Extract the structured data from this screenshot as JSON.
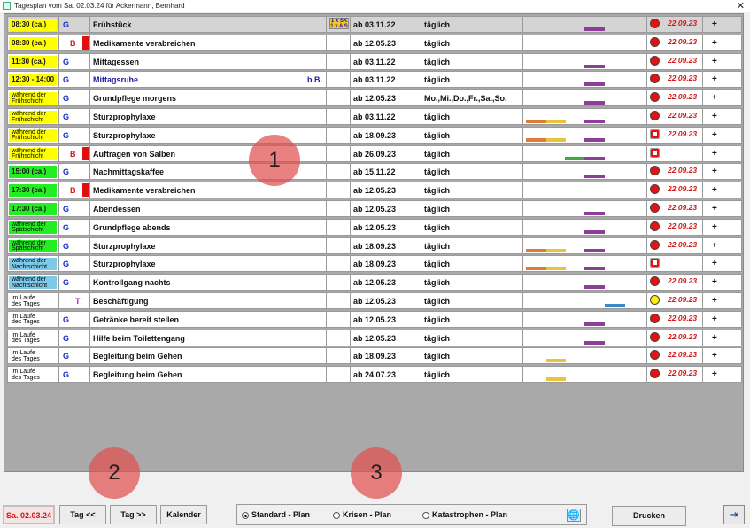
{
  "window": {
    "title": "Tagesplan vom Sa. 02.03.24 für Ackermann, Bernhard",
    "close_symbol": "✕"
  },
  "colors": {
    "time_yellow": "#ffff00",
    "time_green": "#22ee22",
    "time_blue": "#7ec8e8",
    "bar_red": "#e01010",
    "timeline_purple": "#8e3d9a",
    "timeline_orange": "#e07a3a",
    "timeline_yellow": "#e8c43a",
    "timeline_green": "#3caa3c",
    "timeline_blue": "#3a88c8",
    "status_red": "#e81010",
    "status_yellow": "#ffee00",
    "date_red": "#d01818"
  },
  "rows": [
    {
      "time": "08:30 (ca.)",
      "time_color": "yellow",
      "category": "G",
      "cat_color": "blue",
      "red_bar": false,
      "name": "Frühstück",
      "name_right": "",
      "indicator": "1 x SK\n1 x A S",
      "from": "ab 03.11.22",
      "frequency": "täglich",
      "timeline": [
        {
          "color": "purple",
          "start": 0.5,
          "len": 0.17
        }
      ],
      "status": "red",
      "date": "22.09.23",
      "plus": "+"
    },
    {
      "time": "08:30 (ca.)",
      "time_color": "yellow",
      "category": "B",
      "cat_color": "red",
      "red_bar": true,
      "name": "Medikamente verabreichen",
      "name_right": "",
      "indicator": "",
      "from": "ab 12.05.23",
      "frequency": "täglich",
      "timeline": [],
      "status": "red",
      "date": "22.09.23",
      "plus": "+"
    },
    {
      "time": "11:30 (ca.)",
      "time_color": "yellow",
      "category": "G",
      "cat_color": "blue",
      "red_bar": false,
      "name": "Mittagessen",
      "name_right": "",
      "indicator": "",
      "from": "ab 03.11.22",
      "frequency": "täglich",
      "timeline": [
        {
          "color": "purple",
          "start": 0.5,
          "len": 0.17
        }
      ],
      "status": "red",
      "date": "22.09.23",
      "plus": "+"
    },
    {
      "time": "12:30 - 14:00",
      "time_color": "yellow",
      "category": "G",
      "cat_color": "blue",
      "red_bar": false,
      "name": "Mittagsruhe",
      "name_blue": true,
      "name_right": "b.B.",
      "indicator": "",
      "from": "ab 03.11.22",
      "frequency": "täglich",
      "timeline": [
        {
          "color": "purple",
          "start": 0.5,
          "len": 0.17
        }
      ],
      "status": "red",
      "date": "22.09.23",
      "plus": "+"
    },
    {
      "time": "während der\nFrühschicht",
      "time_color": "yellow",
      "category": "G",
      "cat_color": "blue",
      "red_bar": false,
      "name": "Grundpflege morgens",
      "name_right": "",
      "indicator": "",
      "from": "ab 12.05.23",
      "frequency": "Mo.,Mi.,Do.,Fr.,Sa.,So.",
      "timeline": [
        {
          "color": "purple",
          "start": 0.5,
          "len": 0.17
        }
      ],
      "status": "red",
      "date": "22.09.23",
      "plus": "+"
    },
    {
      "time": "während der\nFrühschicht",
      "time_color": "yellow",
      "category": "G",
      "cat_color": "blue",
      "red_bar": false,
      "name": "Sturzprophylaxe",
      "name_right": "",
      "indicator": "",
      "from": "ab 03.11.22",
      "frequency": "täglich",
      "timeline": [
        {
          "color": "orange",
          "start": 0.02,
          "len": 0.17
        },
        {
          "color": "yellow",
          "start": 0.19,
          "len": 0.16
        },
        {
          "color": "purple",
          "start": 0.5,
          "len": 0.17
        }
      ],
      "status": "red",
      "date": "22.09.23",
      "plus": "+"
    },
    {
      "time": "während der\nFrühschicht",
      "time_color": "yellow",
      "category": "G",
      "cat_color": "blue",
      "red_bar": false,
      "name": "Sturzprophylaxe",
      "name_right": "",
      "indicator": "",
      "from": "ab 18.09.23",
      "frequency": "täglich",
      "timeline": [
        {
          "color": "orange",
          "start": 0.02,
          "len": 0.17
        },
        {
          "color": "yellow",
          "start": 0.19,
          "len": 0.16
        },
        {
          "color": "purple",
          "start": 0.5,
          "len": 0.17
        }
      ],
      "status": "red-square",
      "date": "22.09.23",
      "plus": "+"
    },
    {
      "time": "während der\nFrühschicht",
      "time_color": "yellow",
      "category": "B",
      "cat_color": "red",
      "red_bar": true,
      "name": "Auftragen von Salben",
      "name_right": "",
      "indicator": "",
      "from": "ab 26.09.23",
      "frequency": "täglich",
      "timeline": [
        {
          "color": "green",
          "start": 0.34,
          "len": 0.16
        },
        {
          "color": "purple",
          "start": 0.5,
          "len": 0.17
        }
      ],
      "status": "red-square",
      "date": "",
      "plus": "+"
    },
    {
      "time": "15:00 (ca.)",
      "time_color": "green",
      "category": "G",
      "cat_color": "blue",
      "red_bar": false,
      "name": "Nachmittagskaffee",
      "name_right": "",
      "indicator": "",
      "from": "ab 15.11.22",
      "frequency": "täglich",
      "timeline": [
        {
          "color": "purple",
          "start": 0.5,
          "len": 0.17
        }
      ],
      "status": "red",
      "date": "22.09.23",
      "plus": "+"
    },
    {
      "time": "17:30 (ca.)",
      "time_color": "green",
      "category": "B",
      "cat_color": "red",
      "red_bar": true,
      "name": "Medikamente verabreichen",
      "name_right": "",
      "indicator": "",
      "from": "ab 12.05.23",
      "frequency": "täglich",
      "timeline": [],
      "status": "red",
      "date": "22.09.23",
      "plus": "+"
    },
    {
      "time": "17:30 (ca.)",
      "time_color": "green",
      "category": "G",
      "cat_color": "blue",
      "red_bar": false,
      "name": "Abendessen",
      "name_right": "",
      "indicator": "",
      "from": "ab 12.05.23",
      "frequency": "täglich",
      "timeline": [
        {
          "color": "purple",
          "start": 0.5,
          "len": 0.17
        }
      ],
      "status": "red",
      "date": "22.09.23",
      "plus": "+"
    },
    {
      "time": "während der\nSpätschicht",
      "time_color": "green",
      "category": "G",
      "cat_color": "blue",
      "red_bar": false,
      "name": "Grundpflege abends",
      "name_right": "",
      "indicator": "",
      "from": "ab 12.05.23",
      "frequency": "täglich",
      "timeline": [
        {
          "color": "purple",
          "start": 0.5,
          "len": 0.17
        }
      ],
      "status": "red",
      "date": "22.09.23",
      "plus": "+"
    },
    {
      "time": "während der\nSpätschicht",
      "time_color": "green",
      "category": "G",
      "cat_color": "blue",
      "red_bar": false,
      "name": "Sturzprophylaxe",
      "name_right": "",
      "indicator": "",
      "from": "ab 18.09.23",
      "frequency": "täglich",
      "timeline": [
        {
          "color": "orange",
          "start": 0.02,
          "len": 0.17
        },
        {
          "color": "yellow",
          "start": 0.19,
          "len": 0.16
        },
        {
          "color": "purple",
          "start": 0.5,
          "len": 0.17
        }
      ],
      "status": "red",
      "date": "22.09.23",
      "plus": "+"
    },
    {
      "time": "während der\nNachtschicht",
      "time_color": "blue",
      "category": "G",
      "cat_color": "blue",
      "red_bar": false,
      "name": "Sturzprophylaxe",
      "name_right": "",
      "indicator": "",
      "from": "ab 18.09.23",
      "frequency": "täglich",
      "timeline": [
        {
          "color": "orange",
          "start": 0.02,
          "len": 0.17
        },
        {
          "color": "yellow",
          "start": 0.19,
          "len": 0.16
        },
        {
          "color": "purple",
          "start": 0.5,
          "len": 0.17
        }
      ],
      "status": "red-square",
      "date": "",
      "plus": "+"
    },
    {
      "time": "während der\nNachtschicht",
      "time_color": "blue",
      "category": "G",
      "cat_color": "blue",
      "red_bar": false,
      "name": "Kontrollgang nachts",
      "name_right": "",
      "indicator": "",
      "from": "ab 12.05.23",
      "frequency": "täglich",
      "timeline": [
        {
          "color": "purple",
          "start": 0.5,
          "len": 0.17
        }
      ],
      "status": "red",
      "date": "22.09.23",
      "plus": "+"
    },
    {
      "time": "im Laufe\ndes Tages",
      "time_color": "white",
      "category": "T",
      "cat_color": "magenta",
      "red_bar": false,
      "name": "Beschäftigung",
      "name_right": "",
      "indicator": "",
      "from": "ab 12.05.23",
      "frequency": "täglich",
      "timeline": [
        {
          "color": "blue",
          "start": 0.67,
          "len": 0.16
        }
      ],
      "status": "yellow",
      "date": "22.09.23",
      "plus": "+"
    },
    {
      "time": "im Laufe\ndes Tages",
      "time_color": "white",
      "category": "G",
      "cat_color": "blue",
      "red_bar": false,
      "name": "Getränke bereit stellen",
      "name_right": "",
      "indicator": "",
      "from": "ab 12.05.23",
      "frequency": "täglich",
      "timeline": [
        {
          "color": "purple",
          "start": 0.5,
          "len": 0.17
        }
      ],
      "status": "red",
      "date": "22.09.23",
      "plus": "+"
    },
    {
      "time": "im Laufe\ndes Tages",
      "time_color": "white",
      "category": "G",
      "cat_color": "blue",
      "red_bar": false,
      "name": "Hilfe beim Toilettengang",
      "name_right": "",
      "indicator": "",
      "from": "ab 12.05.23",
      "frequency": "täglich",
      "timeline": [
        {
          "color": "purple",
          "start": 0.5,
          "len": 0.17
        }
      ],
      "status": "red",
      "date": "22.09.23",
      "plus": "+"
    },
    {
      "time": "im Laufe\ndes Tages",
      "time_color": "white",
      "category": "G",
      "cat_color": "blue",
      "red_bar": false,
      "name": "Begleitung beim Gehen",
      "name_right": "",
      "indicator": "",
      "from": "ab 18.09.23",
      "frequency": "täglich",
      "timeline": [
        {
          "color": "yellow",
          "start": 0.19,
          "len": 0.16
        }
      ],
      "status": "red",
      "date": "22.09.23",
      "plus": "+"
    },
    {
      "time": "im Laufe\ndes Tages",
      "time_color": "white",
      "category": "G",
      "cat_color": "blue",
      "red_bar": false,
      "name": "Begleitung beim Gehen",
      "name_right": "",
      "indicator": "",
      "from": "ab 24.07.23",
      "frequency": "täglich",
      "timeline": [
        {
          "color": "yellow",
          "start": 0.19,
          "len": 0.16
        }
      ],
      "status": "red",
      "date": "22.09.23",
      "plus": "+"
    }
  ],
  "badges": [
    "1",
    "2",
    "3"
  ],
  "bottom": {
    "date_button": "Sa. 02.03.24",
    "prev_button": "Tag <<",
    "next_button": "Tag >>",
    "calendar_button": "Kalender",
    "radio_standard": "Standard - Plan",
    "radio_krisen": "Krisen - Plan",
    "radio_katastrophen": "Katastrophen - Plan",
    "radio_selected": "standard",
    "print_button": "Drucken",
    "globe_icon": "globe-icon",
    "exit_icon": "exit-door-icon"
  }
}
